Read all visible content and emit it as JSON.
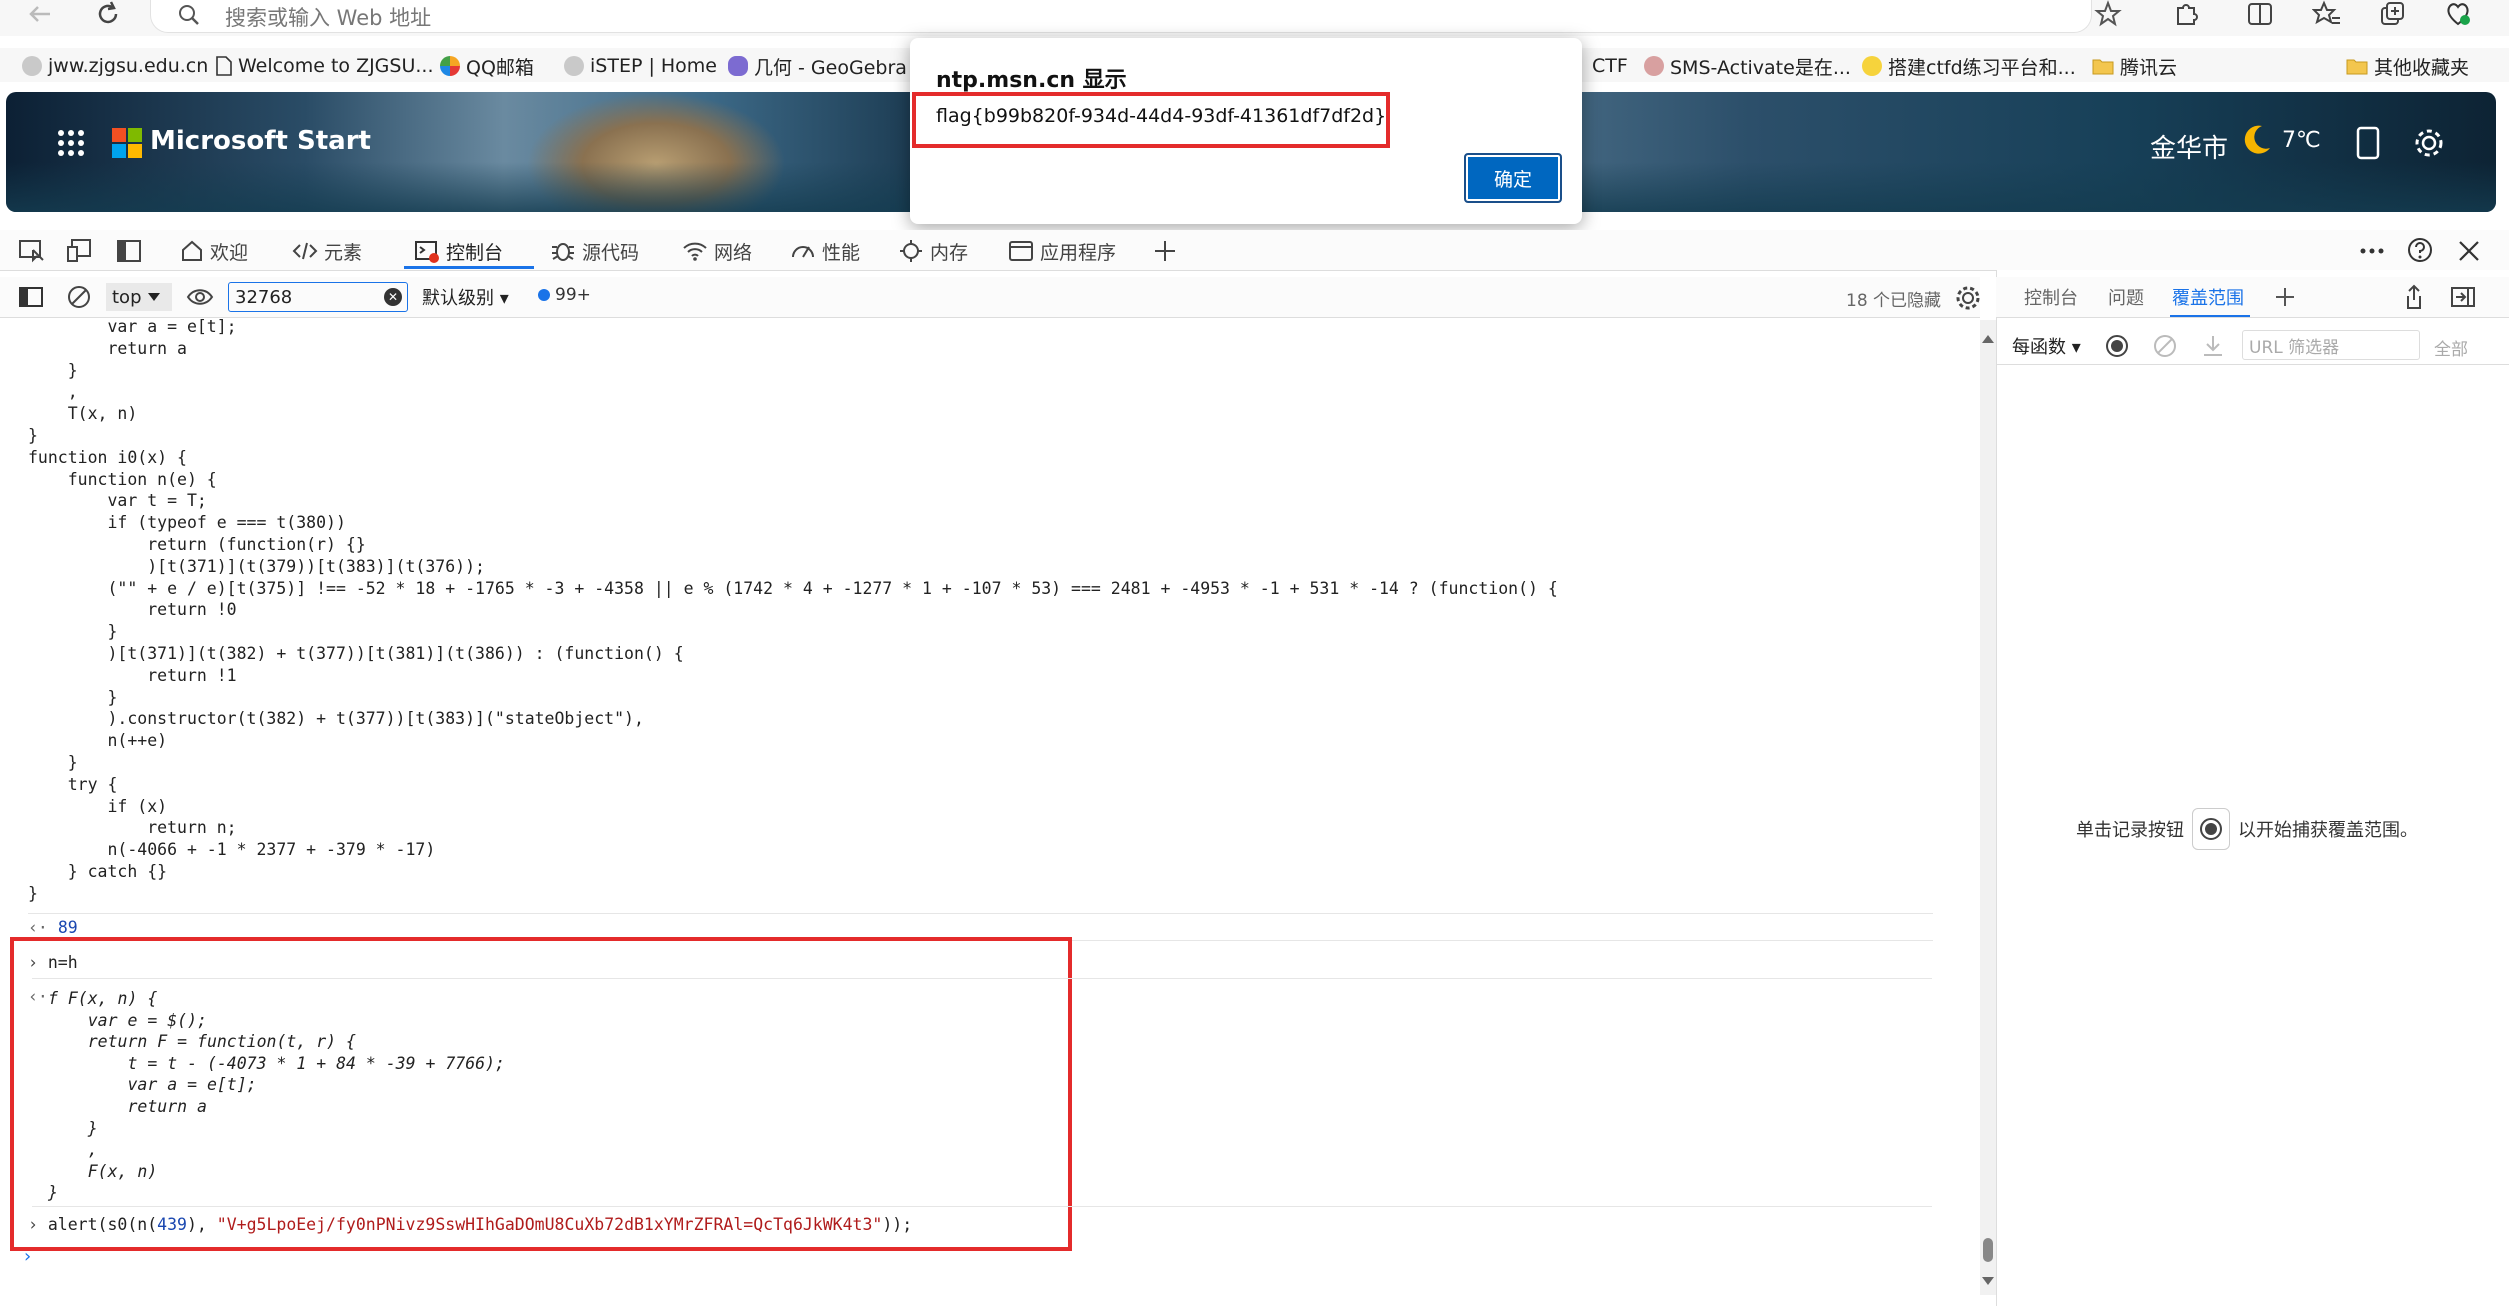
{
  "browser": {
    "address_placeholder": "搜索或输入 Web 地址",
    "bookmarks": [
      {
        "label": "jww.zjgsu.edu.cn"
      },
      {
        "label": "Welcome to ZJGSU..."
      },
      {
        "label": "QQ邮箱"
      },
      {
        "label": "iSTEP | Home"
      },
      {
        "label": "几何 - GeoGebra"
      },
      {
        "label": "CTF"
      },
      {
        "label": "SMS-Activate是在..."
      },
      {
        "label": "搭建ctfd练习平台和..."
      },
      {
        "label": "腾讯云"
      },
      {
        "label": "其他收藏夹"
      }
    ]
  },
  "msn": {
    "title": "Microsoft Start",
    "city": "金华市",
    "temperature": "7℃"
  },
  "dialog": {
    "title": "ntp.msn.cn 显示",
    "message": "flag{b99b820f-934d-44d4-93df-41361df7df2d}",
    "ok_label": "确定"
  },
  "devtools": {
    "tabs": [
      "欢迎",
      "元素",
      "控制台",
      "源代码",
      "网络",
      "性能",
      "内存",
      "应用程序"
    ],
    "active_tab": "控制台",
    "context": "top",
    "filter_value": "32768",
    "levels_label": "默认级别",
    "message_count": "99+",
    "hidden_count": "18 个已隐藏",
    "drawer": {
      "tabs": [
        "控制台",
        "问题",
        "覆盖范围"
      ],
      "active_tab": "覆盖范围",
      "per_function": "每函数",
      "url_filter_placeholder": "URL 筛选器",
      "all_label": "全部",
      "hint_before": "单击记录按钮",
      "hint_after": "以开始捕获覆盖范围。"
    }
  },
  "console": {
    "code_lines": [
      "        var a = e[t];",
      "        return a",
      "    }",
      "    ,",
      "    T(x, n)",
      "}",
      "function i0(x) {",
      "    function n(e) {",
      "        var t = T;",
      "        if (typeof e === t(380))",
      "            return (function(r) {}",
      "            )[t(371)](t(379))[t(383)](t(376));",
      "        (\"\" + e / e)[t(375)] !== -52 * 18 + -1765 * -3 + -4358 || e % (1742 * 4 + -1277 * 1 + -107 * 53) === 2481 + -4953 * -1 + 531 * -14 ? (function() {",
      "            return !0",
      "        }",
      "        )[t(371)](t(382) + t(377))[t(381)](t(386)) : (function() {",
      "            return !1",
      "        }",
      "        ).constructor(t(382) + t(377))[t(383)](\"stateObject\"),",
      "        n(++e)",
      "    }",
      "    try {",
      "        if (x)",
      "            return n;",
      "        n(-4066 + -1 * 2377 + -379 * -17)",
      "    } catch {}",
      "}"
    ],
    "result_value": "89",
    "input_1": "n=h",
    "func_lines": [
      "f F(x, n) {",
      "    var e = $();",
      "    return F = function(t, r) {",
      "        t = t - (-4073 * 1 + 84 * -39 + 7766);",
      "        var a = e[t];",
      "        return a",
      "    }",
      "    ,",
      "    F(x, n)",
      "}"
    ],
    "alert_prefix": "alert(s0(n(",
    "alert_num": "439",
    "alert_mid": "), ",
    "alert_string": "\"V+g5LpoEej/fy0nPNivz9SswHIhGaDOmU8CuXb72dB1xYMrZFRAl=QcTq6JkWK4t3\"",
    "alert_suffix": "));"
  },
  "colors": {
    "accent": "#1a73e8",
    "highlight_box": "#e42b2b",
    "dialog_button": "#0067c0"
  }
}
